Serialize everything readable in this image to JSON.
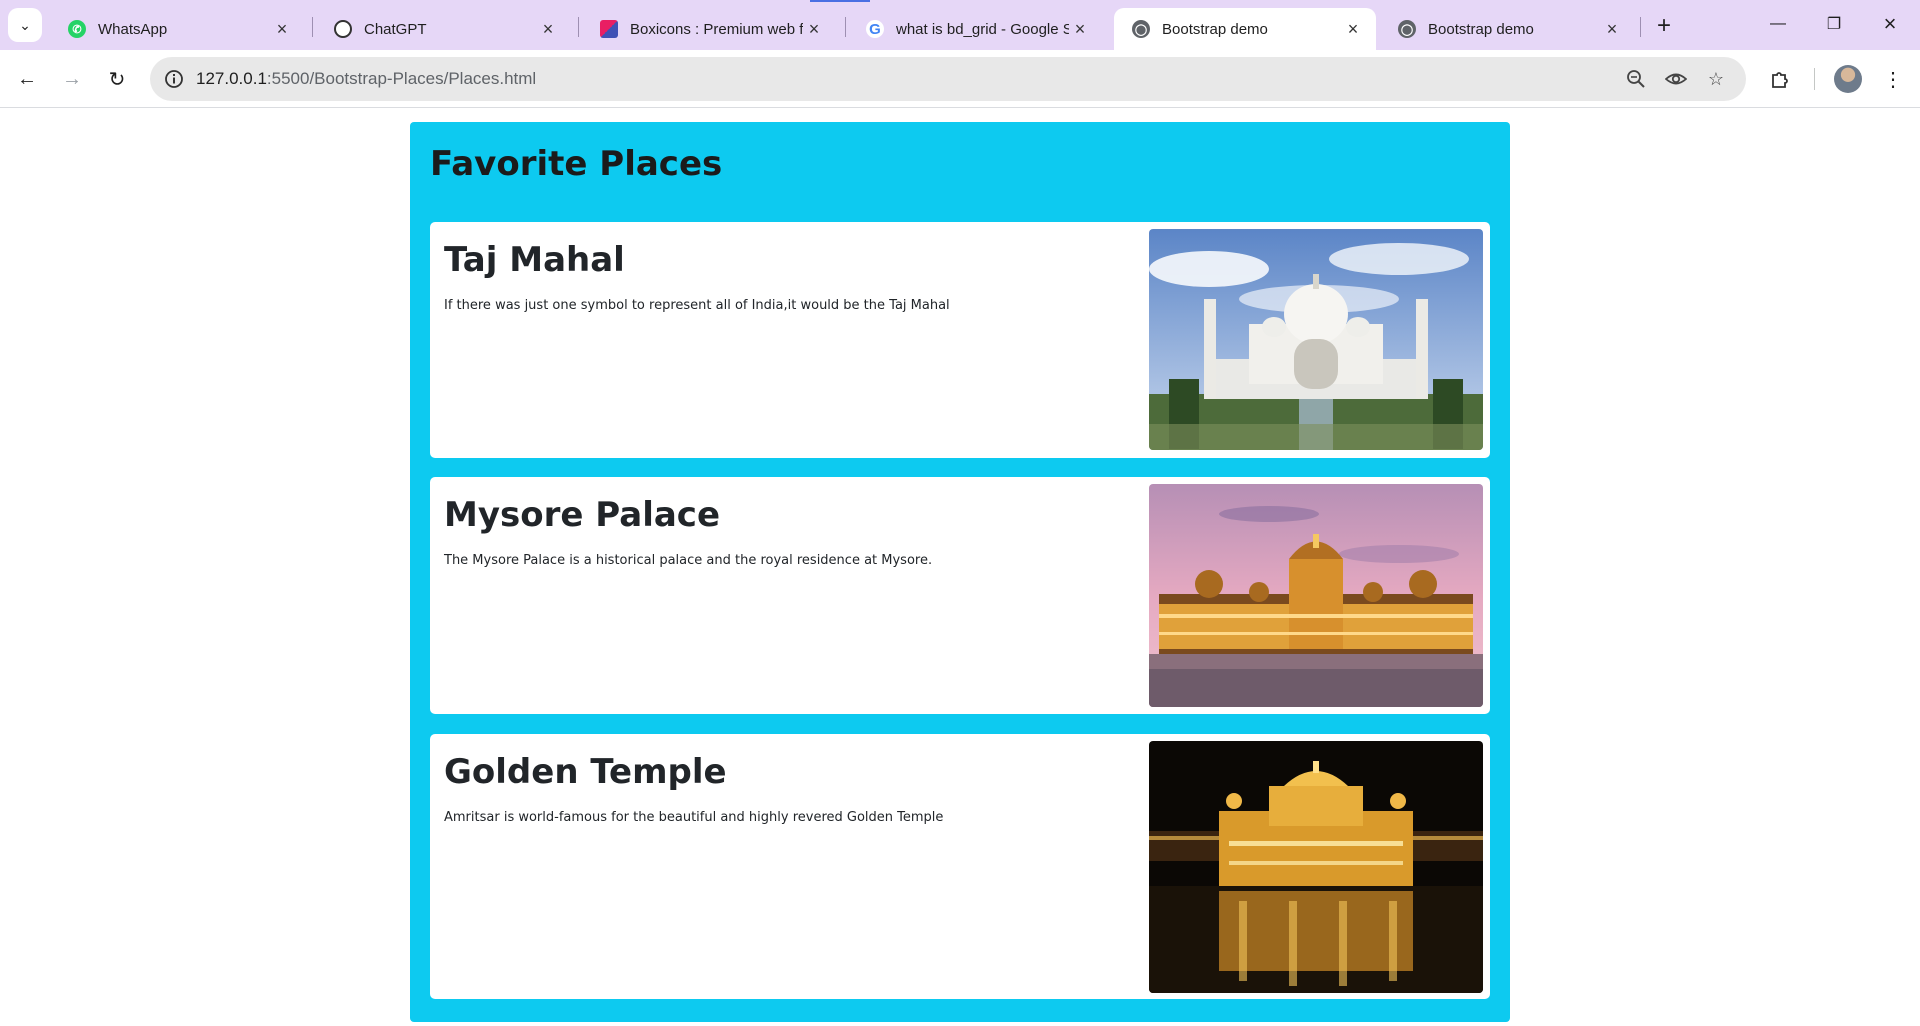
{
  "browser": {
    "tabs": [
      {
        "title": "WhatsApp",
        "icon": "whatsapp-icon",
        "active": false
      },
      {
        "title": "ChatGPT",
        "icon": "chatgpt-icon",
        "active": false
      },
      {
        "title": "Boxicons : Premium web fr",
        "icon": "boxicons-icon",
        "active": false
      },
      {
        "title": "what is bd_grid - Google S",
        "icon": "google-icon",
        "active": false
      },
      {
        "title": "Bootstrap demo",
        "icon": "globe-icon",
        "active": true
      },
      {
        "title": "Bootstrap demo",
        "icon": "globe-icon",
        "active": false
      }
    ],
    "url_host": "127.0.0.1",
    "url_rest": ":5500/Bootstrap-Places/Places.html"
  },
  "page": {
    "heading": "Favorite Places",
    "container_color": "#0dcaf0",
    "places": [
      {
        "title": "Taj Mahal",
        "text": "If there was just one symbol to represent all of India,it would be the Taj Mahal",
        "image": "taj-mahal-photo"
      },
      {
        "title": "Mysore Palace",
        "text": "The Mysore Palace is a historical palace and the royal residence at Mysore.",
        "image": "mysore-palace-photo"
      },
      {
        "title": "Golden Temple",
        "text": "Amritsar is world-famous for the beautiful and highly revered Golden Temple",
        "image": "golden-temple-photo"
      }
    ]
  }
}
